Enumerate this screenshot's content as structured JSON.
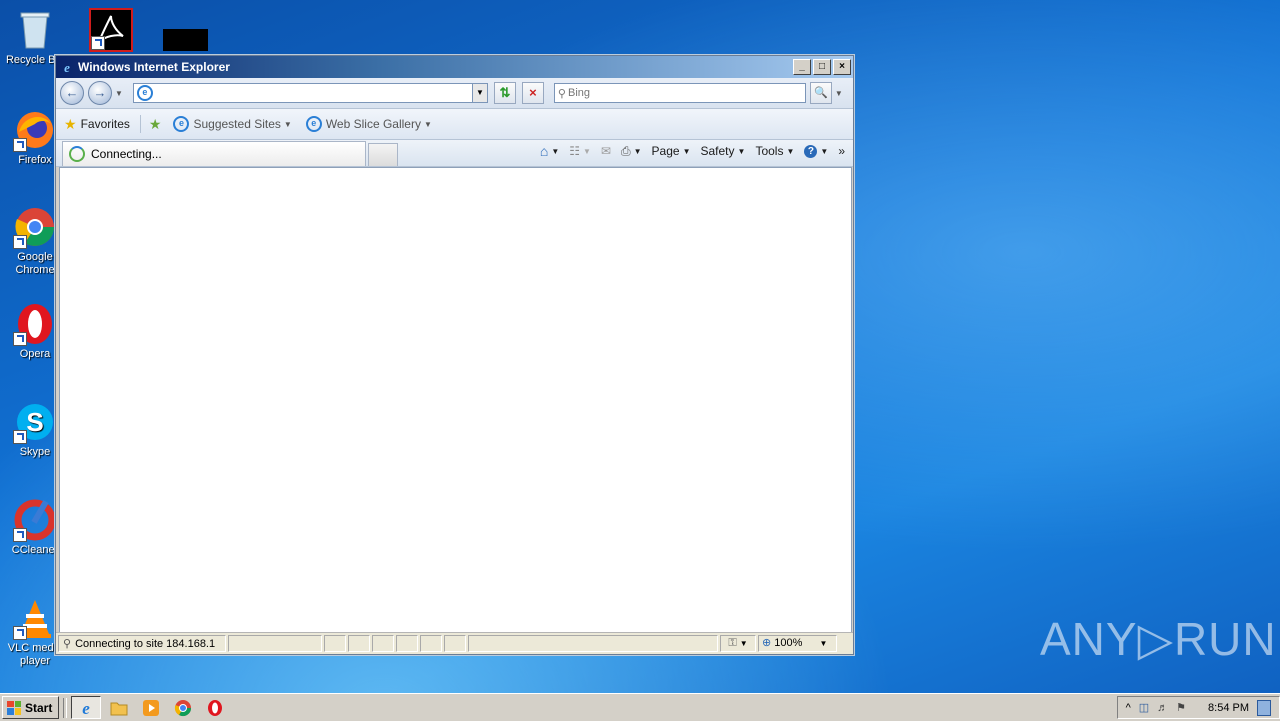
{
  "desktop": {
    "icons": [
      {
        "label": "Recycle Bin"
      },
      {
        "label": "Firefox"
      },
      {
        "label": "Google Chrome"
      },
      {
        "label": "Opera"
      },
      {
        "label": "Skype"
      },
      {
        "label": "CCleaner"
      },
      {
        "label": "VLC media player"
      }
    ]
  },
  "watermark": "ANY▷RUN",
  "window": {
    "title": "Windows Internet Explorer",
    "minimize": "_",
    "maximize": "□",
    "close": "×",
    "address_value": "",
    "search_placeholder": "Bing",
    "favorites_label": "Favorites",
    "suggested_sites": "Suggested Sites",
    "web_slice_gallery": "Web Slice Gallery",
    "tab_label": "Connecting...",
    "commands": {
      "page": "Page",
      "safety": "Safety",
      "tools": "Tools"
    },
    "status_text": "Connecting to site 184.168.1",
    "zoom": "100%"
  },
  "taskbar": {
    "start_label": "Start",
    "clock": "8:54 PM"
  },
  "colors": {
    "titlebar": "#0a246a",
    "desktop": "#1173d6"
  }
}
